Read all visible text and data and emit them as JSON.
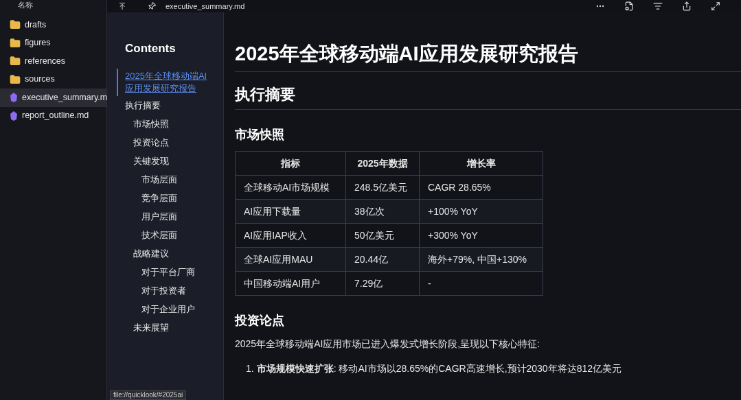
{
  "file_pane": {
    "header": "名称",
    "items": [
      {
        "name": "drafts",
        "kind": "folder",
        "selected": false
      },
      {
        "name": "figures",
        "kind": "folder",
        "selected": false
      },
      {
        "name": "references",
        "kind": "folder",
        "selected": false
      },
      {
        "name": "sources",
        "kind": "folder",
        "selected": false
      },
      {
        "name": "executive_summary.m",
        "kind": "markdown",
        "selected": true
      },
      {
        "name": "report_outline.md",
        "kind": "markdown",
        "selected": false
      }
    ]
  },
  "toolbar": {
    "filename": "executive_summary.md"
  },
  "toc": {
    "title": "Contents",
    "items": [
      {
        "label": "2025年全球移动端AI应用发展研究报告",
        "selected": true,
        "children": [
          {
            "label": "执行摘要",
            "selected": false,
            "children": [
              {
                "label": "市场快照",
                "selected": false
              },
              {
                "label": "投资论点",
                "selected": false
              },
              {
                "label": "关键发现",
                "selected": false,
                "children": [
                  {
                    "label": "市场层面",
                    "selected": false
                  },
                  {
                    "label": "竞争层面",
                    "selected": false
                  },
                  {
                    "label": "用户层面",
                    "selected": false
                  },
                  {
                    "label": "技术层面",
                    "selected": false
                  }
                ]
              },
              {
                "label": "战略建议",
                "selected": false,
                "children": [
                  {
                    "label": "对于平台厂商",
                    "selected": false
                  },
                  {
                    "label": "对于投资者",
                    "selected": false
                  },
                  {
                    "label": "对于企业用户",
                    "selected": false
                  }
                ]
              },
              {
                "label": "未来展望",
                "selected": false
              }
            ]
          }
        ]
      }
    ]
  },
  "document": {
    "title": "2025年全球移动端AI应用发展研究报告",
    "section": "执行摘要",
    "subsection": "市场快照",
    "table": {
      "columns": [
        "指标",
        "2025年数据",
        "增长率"
      ],
      "rows": [
        [
          "全球移动AI市场规模",
          "248.5亿美元",
          "CAGR 28.65%"
        ],
        [
          "AI应用下载量",
          "38亿次",
          "+100% YoY"
        ],
        [
          "AI应用IAP收入",
          "50亿美元",
          "+300% YoY"
        ],
        [
          "全球AI应用MAU",
          "20.44亿",
          "海外+79%, 中国+130%"
        ],
        [
          "中国移动端AI用户",
          "7.29亿",
          "-"
        ]
      ]
    },
    "subsection_2": "投资论点",
    "paragraph": "2025年全球移动端AI应用市场已进入爆发式增长阶段,呈现以下核心特征:",
    "list": [
      {
        "number": "1.",
        "text": "**市场规模快速扩张**: 移动AI市场以28.65%的CAGR高速增长,预计2030年将达812亿美元"
      }
    ]
  },
  "status_bar": {
    "link": "file://quicklook/#2025ai"
  }
}
